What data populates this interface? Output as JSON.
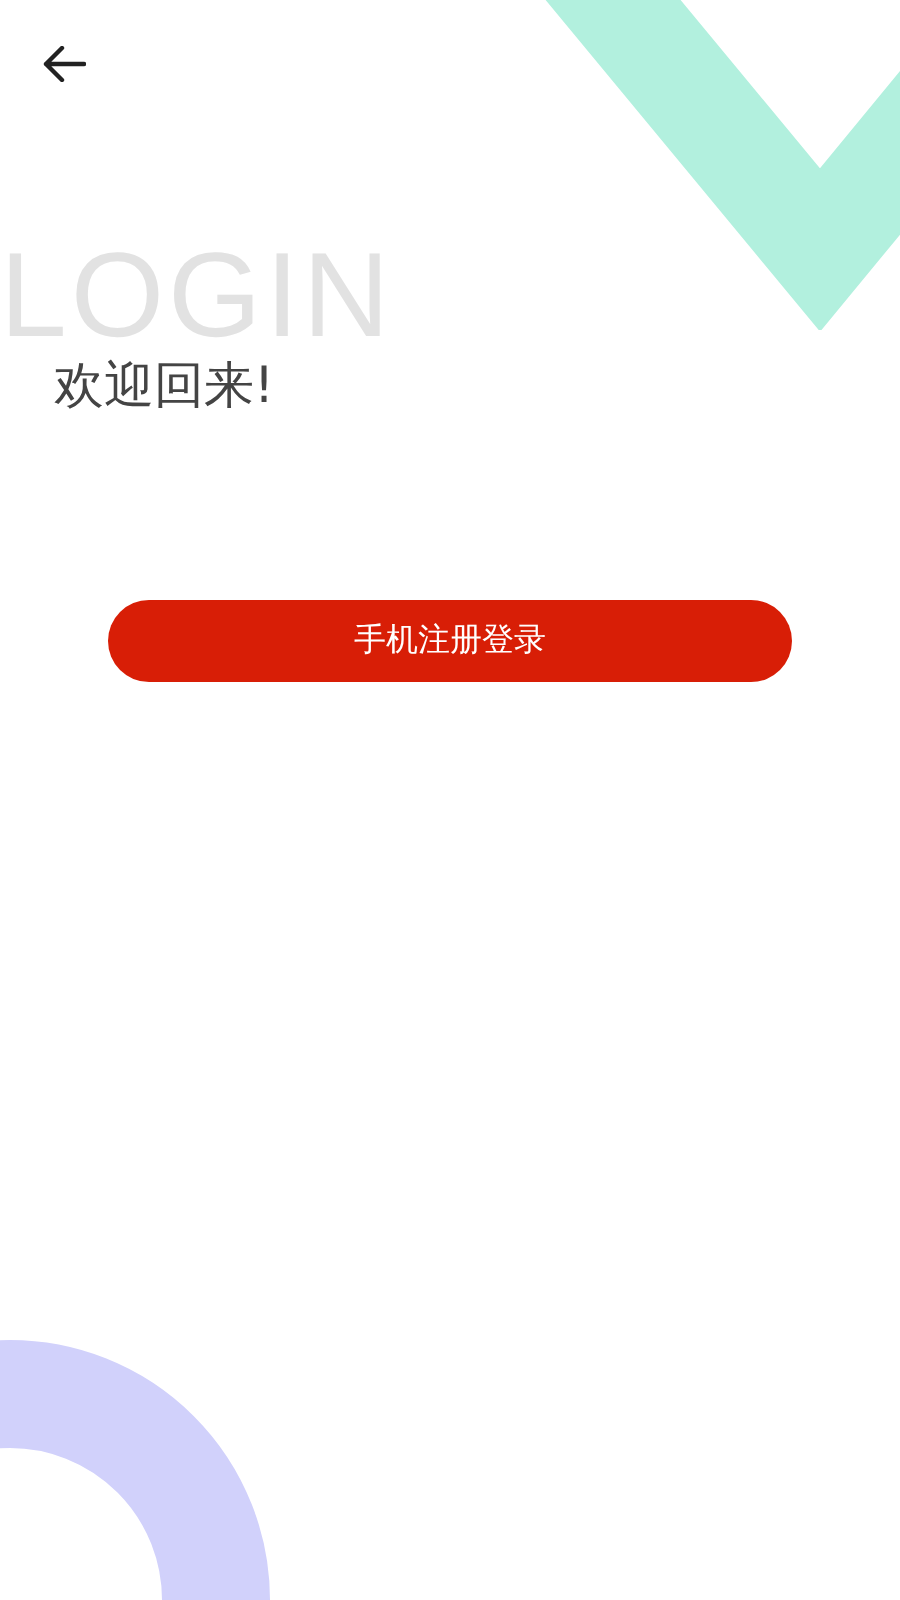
{
  "background_text": "LOGIN",
  "title": "欢迎回来!",
  "buttons": [
    {
      "label": "手机注册登录"
    }
  ]
}
